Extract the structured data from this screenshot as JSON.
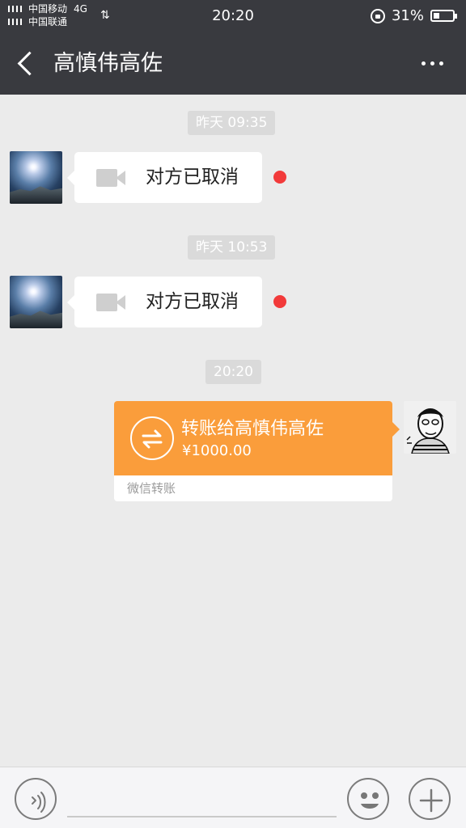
{
  "status_bar": {
    "carrier1": "中国移动",
    "network": "4G",
    "carrier2": "中国联通",
    "time": "20:20",
    "battery": "31%",
    "battery_level": 0.31
  },
  "header": {
    "title": "高慎伟高佐",
    "back_icon": "chevron-left-icon",
    "more_icon": "more-icon"
  },
  "messages": [
    {
      "time": "昨天 09:35",
      "text": "对方已取消",
      "type": "video-call"
    },
    {
      "time": "昨天 10:53",
      "text": "对方已取消",
      "type": "video-call"
    }
  ],
  "transfer": {
    "time": "20:20",
    "title": "转账给高慎伟高佐",
    "amount": "¥1000.00",
    "source": "微信转账",
    "accent": "#fa9d3b"
  },
  "colors": {
    "topbar": "#393a3f",
    "chat_background": "#ebebeb",
    "unread_dot": "#f23a3a"
  },
  "input_bar": {
    "voice_icon": "voice-icon",
    "emoji_icon": "emoji-icon",
    "plus_icon": "plus-icon",
    "placeholder": ""
  }
}
